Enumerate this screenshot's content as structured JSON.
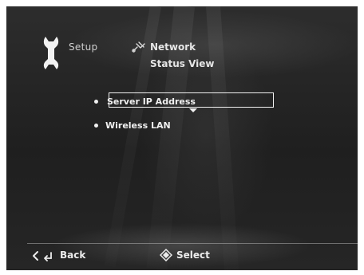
{
  "header": {
    "section_label": "Setup",
    "category_label": "Network",
    "page_title": "Status View"
  },
  "menu": {
    "items": [
      {
        "label": "Server IP Address",
        "selected": true
      },
      {
        "label": "Wireless LAN",
        "selected": false
      }
    ]
  },
  "footer": {
    "back_label": "Back",
    "select_label": "Select"
  },
  "colors": {
    "background": "#262626",
    "text": "#f0f0f0",
    "muted_text": "#cfcfcf"
  },
  "icons": {
    "setup": "wrench-icon",
    "network": "network-icon",
    "back": "back-arrow-icon",
    "select": "select-button-icon"
  }
}
